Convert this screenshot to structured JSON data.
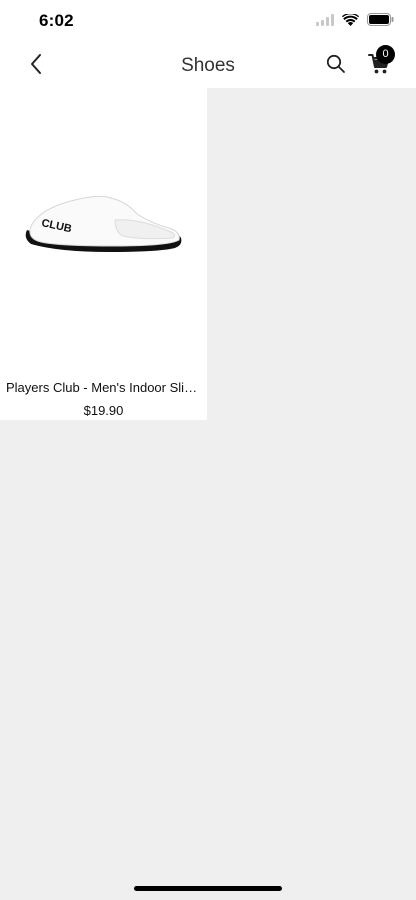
{
  "status_bar": {
    "time": "6:02",
    "icons": [
      "cellular-signal-icon",
      "wifi-icon",
      "battery-icon"
    ]
  },
  "nav": {
    "title": "Shoes",
    "back_icon": "chevron-left-icon",
    "search_icon": "search-icon",
    "cart_icon": "cart-icon",
    "cart_count": "0"
  },
  "products": [
    {
      "name": "Players Club - Men's Indoor Slippers",
      "price": "$19.90",
      "image_label": "CLUB"
    }
  ],
  "colors": {
    "background": "#efefef",
    "card": "#ffffff",
    "badge": "#000000"
  }
}
